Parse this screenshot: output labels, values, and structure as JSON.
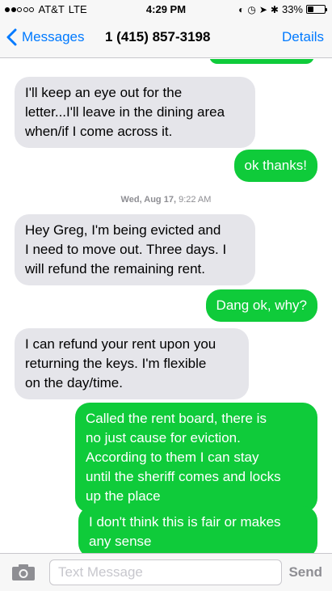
{
  "status": {
    "carrier": "AT&T",
    "network": "LTE",
    "time": "4:29 PM",
    "battery": "33%",
    "battery_level": 0.33,
    "signal_bars": 2
  },
  "nav": {
    "back_label": "Messages",
    "title": "1 (415) 857-3198",
    "details_label": "Details"
  },
  "messages": [
    {
      "dir": "in",
      "text": "I'll keep an eye out for the\nletter...I'll leave in the dining area\nwhen/if I come across it."
    },
    {
      "dir": "out",
      "text": "ok thanks!"
    },
    {
      "dir": "in",
      "text": "Hey Greg, I'm being evicted and\nI need to move out. Three days. I\nwill refund the remaining rent."
    },
    {
      "dir": "out",
      "text": "Dang ok, why?"
    },
    {
      "dir": "in",
      "text": "I can refund your rent upon you\nreturning the keys. I'm flexible\non the day/time."
    },
    {
      "dir": "out",
      "text": "Called the rent board, there is\nno just cause for eviction.\nAccording to them I can stay\nuntil the sheriff comes and locks\nup the place"
    },
    {
      "dir": "out",
      "text": "I don't think this is fair or makes\nany sense"
    }
  ],
  "timestamp": {
    "day": "Wed, Aug 17,",
    "time": "9:22 AM"
  },
  "input": {
    "placeholder": "Text Message",
    "send_label": "Send"
  },
  "colors": {
    "accent": "#007aff",
    "sent_bubble": "#0fcb3a",
    "received_bubble": "#e5e5ea"
  }
}
